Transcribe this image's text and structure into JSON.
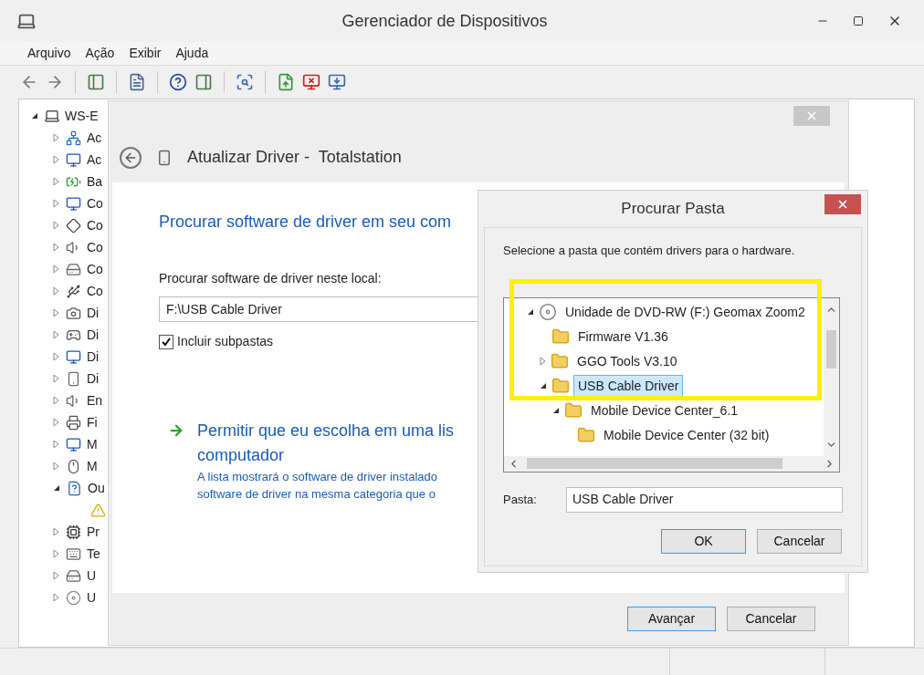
{
  "window": {
    "title": "Gerenciador de Dispositivos"
  },
  "menu": [
    "Arquivo",
    "Ação",
    "Exibir",
    "Ajuda"
  ],
  "tree": {
    "label": "WS-E",
    "expanded": true,
    "children": [
      {
        "label": "Ac",
        "kind": "network",
        "expanded": false
      },
      {
        "label": "Ac",
        "kind": "display",
        "expanded": false
      },
      {
        "label": "Ba",
        "kind": "battery",
        "expanded": false
      },
      {
        "label": "Co",
        "kind": "display",
        "expanded": false
      },
      {
        "label": "Co",
        "kind": "ide",
        "expanded": false
      },
      {
        "label": "Co",
        "kind": "sound",
        "expanded": false
      },
      {
        "label": "Co",
        "kind": "drive",
        "expanded": false
      },
      {
        "label": "Co",
        "kind": "usb",
        "expanded": false
      },
      {
        "label": "Di",
        "kind": "camera",
        "expanded": false
      },
      {
        "label": "Di",
        "kind": "gamepad",
        "expanded": false
      },
      {
        "label": "Di",
        "kind": "display",
        "expanded": false
      },
      {
        "label": "Di",
        "kind": "device",
        "expanded": false
      },
      {
        "label": "En",
        "kind": "sound",
        "expanded": false
      },
      {
        "label": "Fi",
        "kind": "printer",
        "expanded": false
      },
      {
        "label": "M",
        "kind": "display",
        "expanded": false
      },
      {
        "label": "M",
        "kind": "mouse",
        "expanded": false
      },
      {
        "label": "Ou",
        "kind": "unknown",
        "expanded": true,
        "children": [
          {
            "kind": "warning"
          }
        ]
      },
      {
        "label": "Pr",
        "kind": "chip",
        "expanded": false
      },
      {
        "label": "Te",
        "kind": "keyboard",
        "expanded": false
      },
      {
        "label": "U",
        "kind": "drive",
        "expanded": false
      },
      {
        "label": "U",
        "kind": "disc",
        "expanded": false
      }
    ]
  },
  "wizard": {
    "title": "Atualizar Driver -  Totalstation",
    "heading": "Procurar software de driver em seu com",
    "location_label": "Procurar software de driver neste local:",
    "location_value": "F:\\USB Cable Driver",
    "include_subfolders": {
      "label": "Incluir subpastas",
      "checked": true
    },
    "option": {
      "title_lines": [
        "Permitir que eu escolha em uma lis",
        "computador"
      ],
      "description_lines": [
        "A lista mostrará o software de driver instalado",
        "software de driver na mesma categoria que o"
      ]
    },
    "buttons": [
      {
        "label": "Avançar",
        "default": true
      },
      {
        "label": "Cancelar",
        "default": false
      }
    ]
  },
  "folder_dialog": {
    "title": "Procurar Pasta",
    "instruction": "Selecione a pasta que contém drivers para o hardware.",
    "tree": [
      {
        "label": "Unidade de DVD-RW (F:) Geomax Zoom2",
        "kind": "disc",
        "expanded": true,
        "selected": false,
        "children": [
          {
            "label": "Firmware V1.36",
            "kind": "folder",
            "selected": false
          },
          {
            "label": "GGO Tools V3.10",
            "kind": "folder",
            "expanded": false,
            "selected": false
          },
          {
            "label": "USB Cable Driver",
            "kind": "folder",
            "expanded": true,
            "selected": true,
            "children": [
              {
                "label": "Mobile Device Center_6.1",
                "kind": "folder",
                "expanded": true,
                "selected": false,
                "children": [
                  {
                    "label": "Mobile Device Center (32 bit)",
                    "kind": "folder",
                    "selected": false
                  }
                ]
              }
            ]
          }
        ]
      }
    ],
    "folder_label": "Pasta:",
    "folder_value": "USB Cable Driver",
    "buttons": [
      {
        "label": "OK",
        "default": true
      },
      {
        "label": "Cancelar",
        "default": false
      }
    ]
  }
}
